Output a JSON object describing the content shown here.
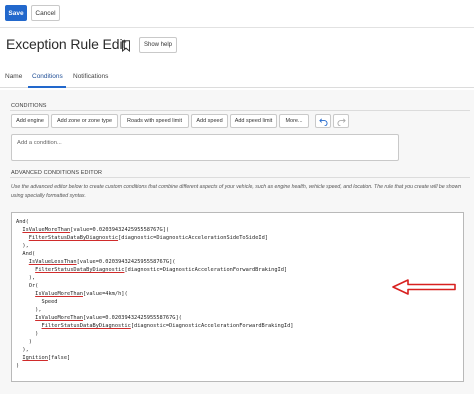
{
  "toolbar": {
    "save_label": "Save",
    "cancel_label": "Cancel"
  },
  "header": {
    "title": "Exception Rule Edit",
    "help_label": "Show help"
  },
  "tabs": [
    {
      "label": "Name"
    },
    {
      "label": "Conditions"
    },
    {
      "label": "Notifications"
    }
  ],
  "conditions": {
    "section_label": "CONDITIONS",
    "buttons": [
      {
        "label": "Add engine"
      },
      {
        "label": "Add zone or zone type"
      },
      {
        "label": "Roads with speed limit"
      },
      {
        "label": "Add speed"
      },
      {
        "label": "Add speed limit"
      },
      {
        "label": "More..."
      }
    ],
    "input_placeholder": "Add a condition..."
  },
  "advanced": {
    "section_label": "ADVANCED CONDITIONS EDITOR",
    "description": "Use the advanced editor below to create custom conditions that combine different aspects of your vehicle, such as engine health, vehicle speed, and location. The rule that you create will be shown using specially formatted syntax.",
    "code": [
      {
        "pre": "And(",
        "ul": "",
        "post": ""
      },
      {
        "pre": "  ",
        "ul": "IsValueMoreThan",
        "post": "[value=0.0203943242595558767G]("
      },
      {
        "pre": "    ",
        "ul": "FilterStatusDataByDiagnostic",
        "post": "[diagnostic=DiagnosticAccelerationSideToSideId]"
      },
      {
        "pre": "  ),",
        "ul": "",
        "post": ""
      },
      {
        "pre": "  And(",
        "ul": "",
        "post": ""
      },
      {
        "pre": "    ",
        "ul": "IsValueLessThan",
        "post": "[value=0.0203943242595558767G]("
      },
      {
        "pre": "      ",
        "ul": "FilterStatusDataByDiagnostic",
        "post": "[diagnostic=DiagnosticAccelerationForwardBrakingId]"
      },
      {
        "pre": "    ),",
        "ul": "",
        "post": ""
      },
      {
        "pre": "    Or(",
        "ul": "",
        "post": ""
      },
      {
        "pre": "      ",
        "ul": "IsValueMoreThan",
        "post": "[value=4km/h]("
      },
      {
        "pre": "        Speed",
        "ul": "",
        "post": ""
      },
      {
        "pre": "      ),",
        "ul": "",
        "post": ""
      },
      {
        "pre": "      ",
        "ul": "IsValueMoreThan",
        "post": "[value=0.0203943242595558767G]("
      },
      {
        "pre": "        ",
        "ul": "FilterStatusDataByDiagnostic",
        "post": "[diagnostic=DiagnosticAccelerationForwardBrakingId]"
      },
      {
        "pre": "      )",
        "ul": "",
        "post": ""
      },
      {
        "pre": "    )",
        "ul": "",
        "post": ""
      },
      {
        "pre": "  ),",
        "ul": "",
        "post": ""
      },
      {
        "pre": "  ",
        "ul": "Ignition",
        "post": "[false]"
      },
      {
        "pre": ")",
        "ul": "",
        "post": ""
      }
    ]
  },
  "icons": {
    "bookmark": "bookmark-icon",
    "undo": "undo-icon",
    "redo": "redo-icon",
    "annotation_arrow": "red-arrow-icon"
  },
  "colors": {
    "primary": "#2268cc",
    "annotation": "#d8201f",
    "error_underline": "#d02b2b"
  }
}
